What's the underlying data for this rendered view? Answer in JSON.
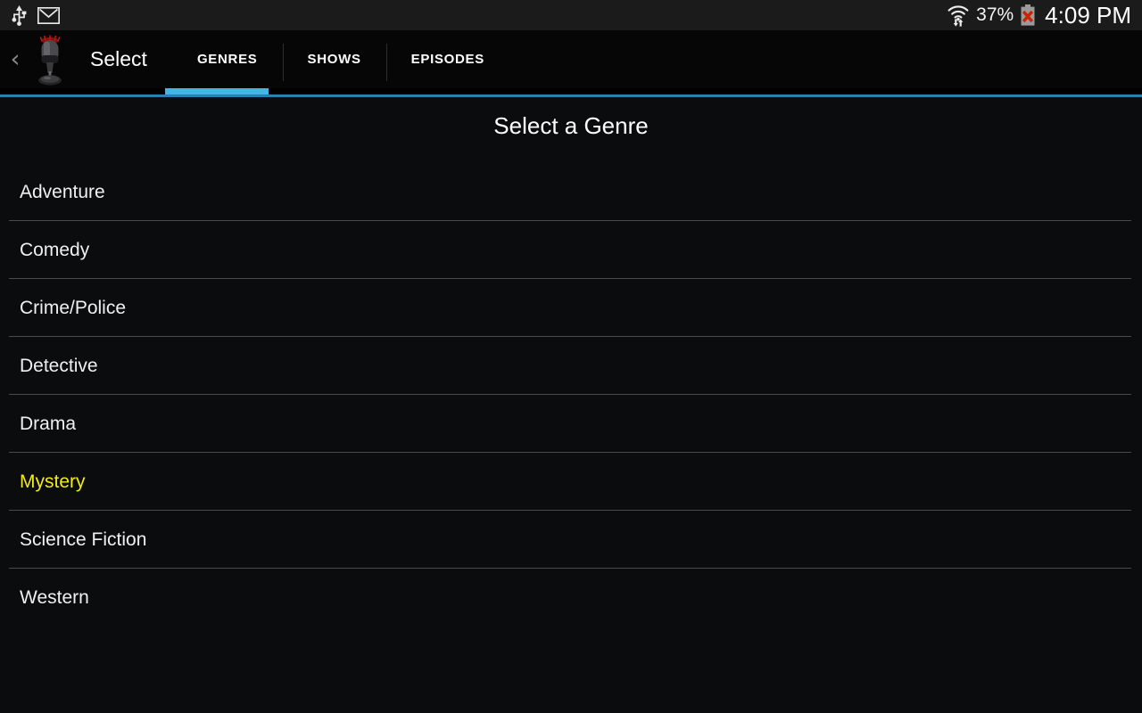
{
  "status_bar": {
    "left_icons": [
      {
        "name": "usb-icon",
        "label": "USB"
      },
      {
        "name": "gmail-icon",
        "label": "Gmail"
      }
    ],
    "wifi_icon": "wifi-data-icon",
    "battery_percent": "37%",
    "battery_icon": "battery-error-icon",
    "clock": "4:09 PM",
    "colors": {
      "background": "#1b1b1b",
      "text": "#ffffff",
      "battery_x": "#cc2200"
    }
  },
  "action_bar": {
    "back_icon": "back-chevron-icon",
    "back_glyph": "‹",
    "app_icon": "microphone-icon",
    "title": "Select",
    "tabs": [
      {
        "label": "GENRES",
        "active": true
      },
      {
        "label": "SHOWS",
        "active": false
      },
      {
        "label": "EPISODES",
        "active": false
      }
    ],
    "colors": {
      "background": "#060606",
      "active_indicator": "#41b6e6",
      "underline_track": "#2881ae",
      "title": "#ffffff"
    }
  },
  "content": {
    "page_title": "Select a Genre",
    "background": "#0a0c0e",
    "selected_color": "#f2ea18",
    "item_color": "#f0f0f0",
    "divider_color": "#4a4a4a",
    "genres": [
      {
        "label": "Adventure",
        "selected": false
      },
      {
        "label": "Comedy",
        "selected": false
      },
      {
        "label": "Crime/Police",
        "selected": false
      },
      {
        "label": "Detective",
        "selected": false
      },
      {
        "label": "Drama",
        "selected": false
      },
      {
        "label": "Mystery",
        "selected": true
      },
      {
        "label": "Science Fiction",
        "selected": false
      },
      {
        "label": "Western",
        "selected": false
      }
    ]
  }
}
